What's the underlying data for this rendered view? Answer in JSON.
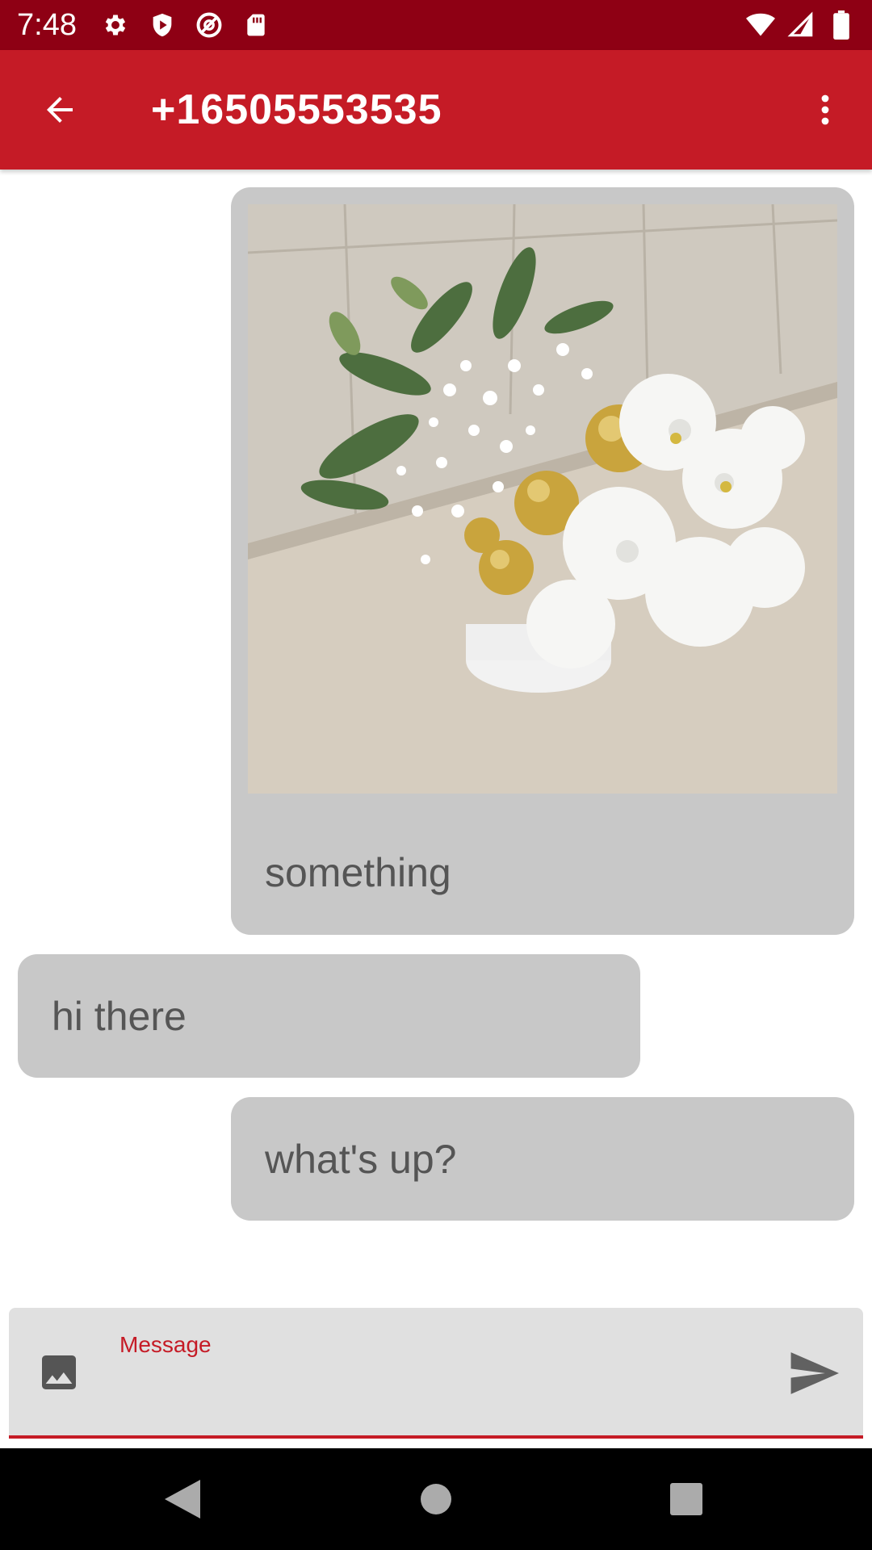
{
  "status_bar": {
    "time": "7:48",
    "left_icons": [
      "settings-icon",
      "shield-play-icon",
      "no-disturb-icon",
      "sd-card-icon"
    ],
    "right_icons": [
      "wifi-icon",
      "signal-icon",
      "battery-icon"
    ]
  },
  "app_bar": {
    "title": "+16505553535",
    "back_icon": "arrow-back-icon",
    "menu_icon": "more-vert-icon"
  },
  "messages": [
    {
      "direction": "outgoing",
      "has_image": true,
      "image_desc": "flower-bouquet-photo",
      "text": "something"
    },
    {
      "direction": "incoming",
      "text": "hi there"
    },
    {
      "direction": "outgoing",
      "text": "what's up?"
    }
  ],
  "composer": {
    "label": "Message",
    "value": "",
    "attach_icon": "image-icon",
    "send_icon": "send-icon"
  },
  "nav_bar": {
    "buttons": [
      "back-triangle-icon",
      "home-circle-icon",
      "recents-square-icon"
    ]
  },
  "colors": {
    "status_bar": "#8e0014",
    "app_bar": "#c51b26",
    "bubble": "#c8c8c8",
    "composer_bg": "#e0e0e0",
    "accent": "#c51b26"
  }
}
